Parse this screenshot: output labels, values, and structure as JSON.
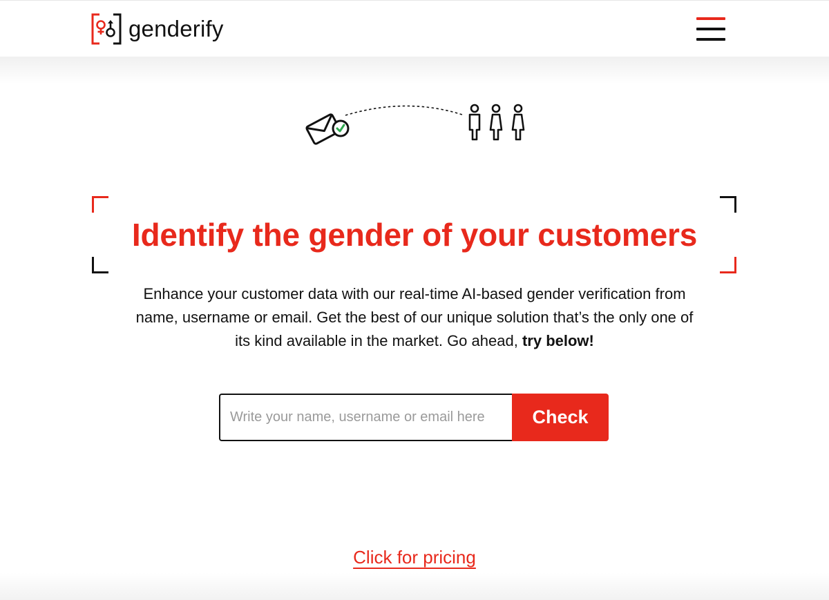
{
  "brand": {
    "name": "genderify",
    "accent": "#e8291c",
    "dark": "#111111"
  },
  "header": {
    "menu_icon": "hamburger-menu-icon"
  },
  "illustration": {
    "icons": [
      "envelope-check-icon",
      "dashed-connector",
      "people-group-icon"
    ],
    "check_color": "#2fa84f"
  },
  "hero": {
    "title": "Identify the gender of your customers",
    "description": "Enhance your customer data with our real-time AI-based gender verification from name, username or email. Get the best of our unique solution that’s the only one of its kind available in the market. Go ahead,",
    "description_emphasis": "try below!"
  },
  "form": {
    "placeholder": "Write your name, username or email here",
    "value": "",
    "button_label": "Check"
  },
  "footer": {
    "pricing_link": "Click for pricing"
  }
}
